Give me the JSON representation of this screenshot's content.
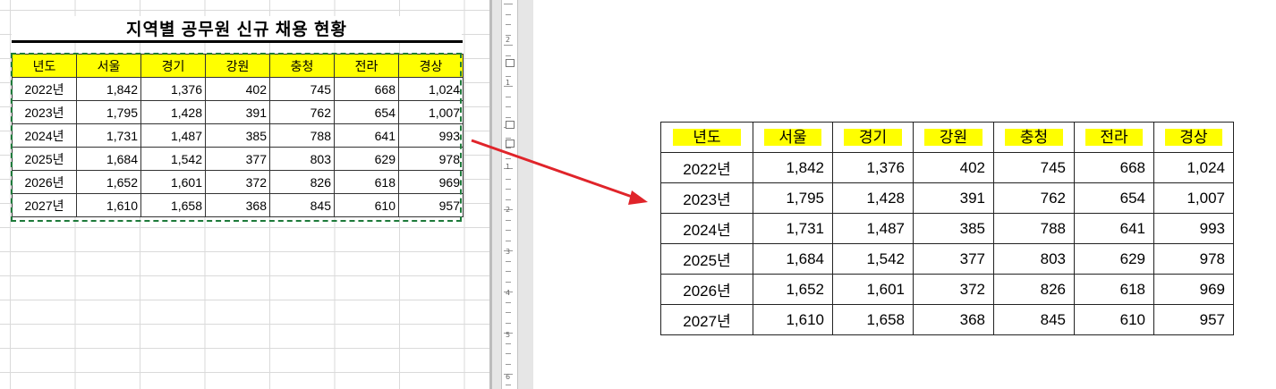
{
  "title": "지역별 공무원 신규 채용 현황",
  "columns": [
    "년도",
    "서울",
    "경기",
    "강원",
    "충청",
    "전라",
    "경상"
  ],
  "rows": [
    [
      "2022년",
      "1,842",
      "1,376",
      "402",
      "745",
      "668",
      "1,024"
    ],
    [
      "2023년",
      "1,795",
      "1,428",
      "391",
      "762",
      "654",
      "1,007"
    ],
    [
      "2024년",
      "1,731",
      "1,487",
      "385",
      "788",
      "641",
      "993"
    ],
    [
      "2025년",
      "1,684",
      "1,542",
      "377",
      "803",
      "629",
      "978"
    ],
    [
      "2026년",
      "1,652",
      "1,601",
      "372",
      "826",
      "618",
      "969"
    ],
    [
      "2027년",
      "1,610",
      "1,658",
      "368",
      "845",
      "610",
      "957"
    ]
  ],
  "ruler_numbers": [
    "2",
    "1",
    "1",
    "2",
    "3",
    "4",
    "5",
    "6"
  ],
  "colors": {
    "header_fill": "#ffff00",
    "marquee": "#1d7a3a",
    "arrow": "#e0242a"
  }
}
